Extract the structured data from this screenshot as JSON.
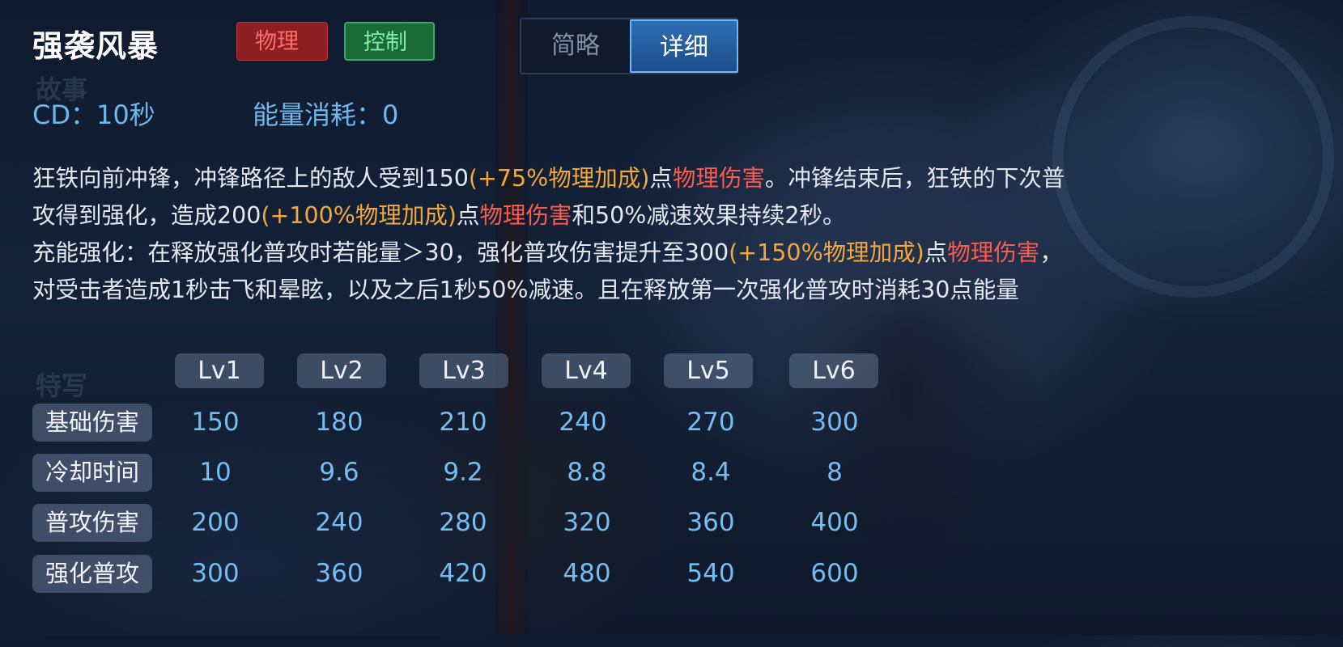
{
  "skill": {
    "name": "强袭风暴",
    "tags": [
      "物理",
      "控制"
    ],
    "view_toggle": {
      "brief": "简略",
      "detail": "详细",
      "active": "详细"
    },
    "cd_text": "CD：10秒",
    "energy_text": "能量消耗：0",
    "colors": {
      "accent": "#6fb8ee",
      "bonus": "#f2a93b",
      "damage": "#ff5a4e",
      "tag_physical": "#8e1f22",
      "tag_control": "#1b6b3a"
    }
  },
  "description": {
    "line1": {
      "a": "狂铁向前冲锋，冲锋路径上的敌人受到150",
      "b": "(+75%物理加成)",
      "c": "点",
      "d": "物理伤害",
      "e": "。冲锋结束后，狂铁的下次普"
    },
    "line2": {
      "a": "攻得到强化，造成200",
      "b": "(+100%物理加成)",
      "c": "点",
      "d": "物理伤害",
      "e": "和50%减速效果持续2秒。"
    },
    "line3": {
      "a": "充能强化：在释放强化普攻时若能量＞30，强化普攻伤害提升至300",
      "b": "(+150%物理加成)",
      "c": "点",
      "d": "物理伤害",
      "e": "，"
    },
    "line4": {
      "a": "对受击者造成1秒击飞和晕眩，以及之后1秒50%减速。且在释放第一次强化普攻时消耗30点能量"
    }
  },
  "levels": [
    "Lv1",
    "Lv2",
    "Lv3",
    "Lv4",
    "Lv5",
    "Lv6"
  ],
  "stats": [
    {
      "label": "基础伤害",
      "values": [
        "150",
        "180",
        "210",
        "240",
        "270",
        "300"
      ]
    },
    {
      "label": "冷却时间",
      "values": [
        "10",
        "9.6",
        "9.2",
        "8.8",
        "8.4",
        "8"
      ]
    },
    {
      "label": "普攻伤害",
      "values": [
        "200",
        "240",
        "280",
        "320",
        "360",
        "400"
      ]
    },
    {
      "label": "强化普攻",
      "values": [
        "300",
        "360",
        "420",
        "480",
        "540",
        "600"
      ]
    }
  ],
  "background_ghost_text": [
    "故事",
    "特写"
  ]
}
